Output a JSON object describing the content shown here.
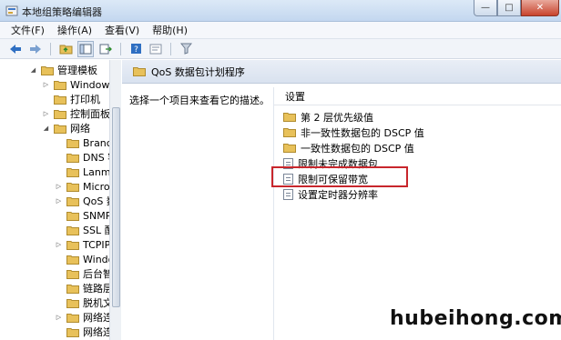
{
  "window": {
    "title": "本地组策略编辑器",
    "controls": {
      "minimize": "—",
      "maximize": "□",
      "close": "✕"
    }
  },
  "menubar": {
    "items": [
      {
        "label": "文件(F)"
      },
      {
        "label": "操作(A)"
      },
      {
        "label": "查看(V)"
      },
      {
        "label": "帮助(H)"
      }
    ]
  },
  "toolbar": {
    "buttons": [
      "back-arrow-icon",
      "forward-arrow-icon",
      "up-folder-icon",
      "show-hide-tree-icon",
      "export-list-icon",
      "help-icon",
      "properties-icon",
      "filter-icon"
    ]
  },
  "tree": {
    "items": [
      {
        "label": "管理模板",
        "expander": "open",
        "level": 0
      },
      {
        "label": "Windows",
        "expander": "closed",
        "level": 1
      },
      {
        "label": "打印机",
        "expander": "none",
        "level": 1
      },
      {
        "label": "控制面板",
        "expander": "closed",
        "level": 1
      },
      {
        "label": "网络",
        "expander": "open",
        "level": 1
      },
      {
        "label": "Branch",
        "expander": "none",
        "level": 2
      },
      {
        "label": "DNS 客",
        "expander": "none",
        "level": 2
      },
      {
        "label": "Lanma",
        "expander": "none",
        "level": 2
      },
      {
        "label": "Micro",
        "expander": "closed",
        "level": 2
      },
      {
        "label": "QoS 数",
        "expander": "closed",
        "level": 2
      },
      {
        "label": "SNMP",
        "expander": "none",
        "level": 2
      },
      {
        "label": "SSL 配",
        "expander": "none",
        "level": 2
      },
      {
        "label": "TCPIP",
        "expander": "closed",
        "level": 2
      },
      {
        "label": "Windo",
        "expander": "none",
        "level": 2
      },
      {
        "label": "后台智",
        "expander": "none",
        "level": 2
      },
      {
        "label": "链路层",
        "expander": "none",
        "level": 2
      },
      {
        "label": "脱机文",
        "expander": "none",
        "level": 2
      },
      {
        "label": "网络连",
        "expander": "closed",
        "level": 2
      },
      {
        "label": "网络连",
        "expander": "none",
        "level": 2
      }
    ]
  },
  "content": {
    "header_title": "QoS 数据包计划程序",
    "description": "选择一个项目来查看它的描述。",
    "column_header": "设置",
    "items": [
      {
        "label": "第 2 层优先级值",
        "type": "folder"
      },
      {
        "label": "非一致性数据包的 DSCP 值",
        "type": "folder"
      },
      {
        "label": "一致性数据包的 DSCP 值",
        "type": "folder"
      },
      {
        "label": "限制未完成数据包",
        "type": "setting"
      },
      {
        "label": "限制可保留带宽",
        "type": "setting"
      },
      {
        "label": "设置定时器分辨率",
        "type": "setting"
      }
    ]
  },
  "watermark": "hubeihong.com",
  "colors": {
    "highlight": "#c8262c",
    "folder": "#e8c15a",
    "header_bg": "#dfe7f2"
  }
}
